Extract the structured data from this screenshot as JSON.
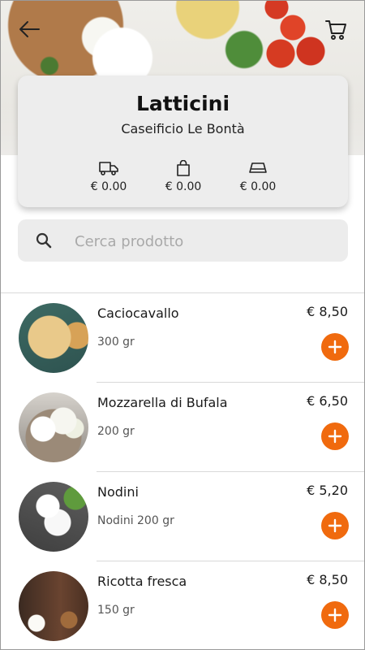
{
  "colors": {
    "accent": "#f06a0e",
    "card_bg": "#ededed",
    "search_bg": "#ececec",
    "divider": "#d9d9d9"
  },
  "header": {
    "back_icon": "arrow-left-icon",
    "cart_icon": "cart-icon"
  },
  "shop": {
    "title": "Latticini",
    "subtitle": "Caseificio Le Bontà",
    "stats": [
      {
        "icon": "truck-icon",
        "value": "€ 0.00"
      },
      {
        "icon": "shopping-bag-icon",
        "value": "€ 0.00"
      },
      {
        "icon": "tray-icon",
        "value": "€ 0.00"
      }
    ]
  },
  "search": {
    "icon": "search-icon",
    "placeholder": "Cerca prodotto",
    "value": ""
  },
  "products": [
    {
      "name": "Caciocavallo",
      "weight": "300 gr",
      "price": "€ 8,50"
    },
    {
      "name": "Mozzarella di Bufala",
      "weight": "200 gr",
      "price": "€ 6,50"
    },
    {
      "name": "Nodini",
      "weight": "Nodini 200 gr",
      "price": "€ 5,20"
    },
    {
      "name": "Ricotta fresca",
      "weight": "150 gr",
      "price": "€ 8,50"
    }
  ]
}
